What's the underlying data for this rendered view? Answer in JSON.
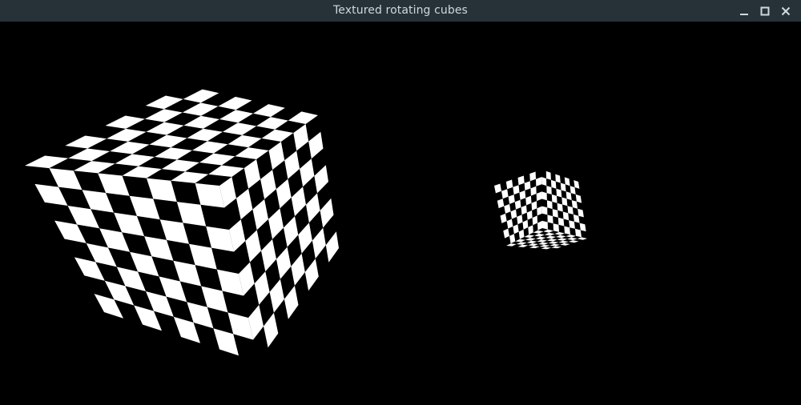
{
  "window": {
    "title": "Textured rotating cubes"
  },
  "controls": {
    "minimize_icon": "minimize-icon",
    "maximize_icon": "maximize-icon",
    "close_icon": "close-icon"
  },
  "scene": {
    "background_color": "#000000",
    "titlebar_color": "#263238",
    "title_color": "#cfd8dc",
    "checker_light": "#ffffff",
    "checker_dark": "#000000",
    "cubes": [
      {
        "name": "large-cube",
        "checker_divisions": 8
      },
      {
        "name": "small-cube",
        "checker_divisions": 8
      }
    ]
  }
}
